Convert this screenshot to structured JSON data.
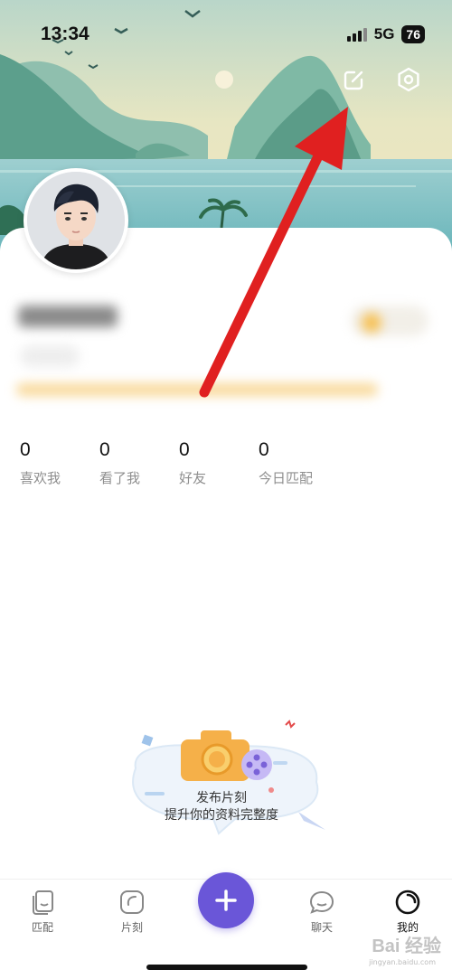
{
  "status_bar": {
    "time": "13:34",
    "network": "5G",
    "battery": "76"
  },
  "header": {
    "edit_icon": "edit-icon",
    "settings_icon": "settings-hexagon-icon"
  },
  "stats": [
    {
      "value": "0",
      "label": "喜欢我"
    },
    {
      "value": "0",
      "label": "看了我"
    },
    {
      "value": "0",
      "label": "好友"
    },
    {
      "value": "0",
      "label": "今日匹配"
    }
  ],
  "empty_state": {
    "title": "发布片刻",
    "subtitle": "提升你的资料完整度"
  },
  "tab_bar": {
    "items": [
      {
        "label": "匹配",
        "icon": "cards-icon"
      },
      {
        "label": "片刻",
        "icon": "moment-icon"
      },
      {
        "label": "聊天",
        "icon": "chat-bubble-icon"
      },
      {
        "label": "我的",
        "icon": "profile-ring-icon"
      }
    ],
    "publish_icon": "plus-icon",
    "active": "我的"
  },
  "watermark": {
    "text": "Bai 经验",
    "sub": "jingyan.baidu.com"
  },
  "colors": {
    "accent": "#6a56d8",
    "annotation_arrow": "#e02020"
  }
}
